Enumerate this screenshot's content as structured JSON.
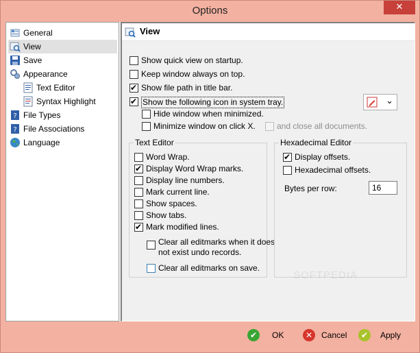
{
  "window": {
    "title": "Options",
    "close_glyph": "✕"
  },
  "nav": {
    "items": [
      {
        "label": "General",
        "icon": "general-icon"
      },
      {
        "label": "View",
        "icon": "view-icon"
      },
      {
        "label": "Save",
        "icon": "save-icon"
      },
      {
        "label": "Appearance",
        "icon": "appearance-icon"
      },
      {
        "label": "Text Editor",
        "icon": "text-editor-icon"
      },
      {
        "label": "Syntax Highlight",
        "icon": "syntax-highlight-icon"
      },
      {
        "label": "File Types",
        "icon": "file-types-icon"
      },
      {
        "label": "File Associations",
        "icon": "file-associations-icon"
      },
      {
        "label": "Language",
        "icon": "language-icon"
      }
    ],
    "selected": "View"
  },
  "view": {
    "title": "View",
    "options": [
      {
        "label": "Show quick view on startup.",
        "checked": false
      },
      {
        "label": "Keep window always on top.",
        "checked": false
      },
      {
        "label": "Show file path in title bar.",
        "checked": true
      },
      {
        "label": "Show the following icon in system tray.",
        "checked": true
      },
      {
        "label": "Hide window when minimized.",
        "checked": false
      },
      {
        "label": "Minimize window on click X.",
        "checked": false
      },
      {
        "label": "and close all documents.",
        "checked": false,
        "disabled": true
      }
    ],
    "tray_icon_select": {
      "selected_icon": "pencil-icon",
      "arrow": "⌄"
    }
  },
  "text_editor": {
    "title": "Text Editor",
    "options": [
      {
        "label": "Word Wrap.",
        "checked": false
      },
      {
        "label": "Display Word Wrap marks.",
        "checked": true
      },
      {
        "label": "Display line numbers.",
        "checked": false
      },
      {
        "label": "Mark current line.",
        "checked": false
      },
      {
        "label": "Show spaces.",
        "checked": false
      },
      {
        "label": "Show tabs.",
        "checked": false
      },
      {
        "label": "Mark modified lines.",
        "checked": true
      }
    ],
    "sub_options": [
      {
        "label_line1": "Clear all editmarks when it does",
        "label_line2": "not exist undo records.",
        "checked": false
      },
      {
        "label": "Clear all editmarks on save.",
        "checked": false
      }
    ]
  },
  "hex_editor": {
    "title": "Hexadecimal Editor",
    "options": [
      {
        "label": "Display offsets.",
        "checked": true
      },
      {
        "label": "Hexadecimal offsets.",
        "checked": false
      }
    ],
    "bytes_per_row_label": "Bytes per row:",
    "bytes_per_row_value": "16"
  },
  "footer": {
    "ok": "OK",
    "cancel": "Cancel",
    "apply": "Apply",
    "ok_glyph": "✔",
    "cancel_glyph": "✕",
    "apply_glyph": "✔"
  },
  "colors": {
    "frame": "#f3b1a1",
    "close_button": "#c7403a",
    "ok_icon": "#3aa535",
    "cancel_icon": "#d6362c",
    "apply_icon": "#a9c22b"
  }
}
